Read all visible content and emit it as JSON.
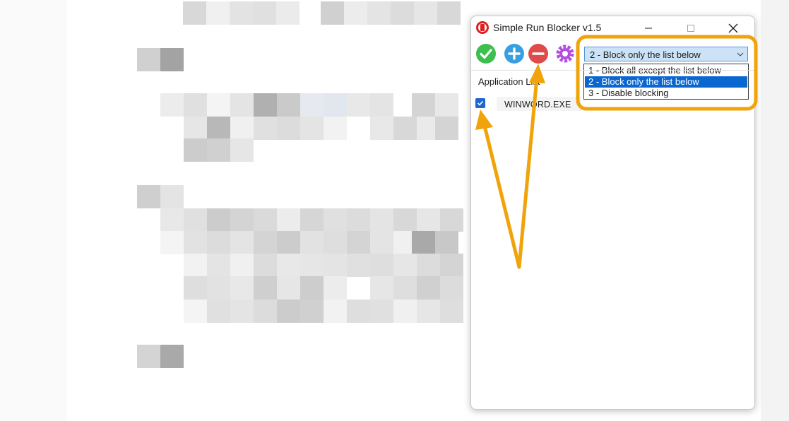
{
  "window": {
    "title": "Simple Run Blocker v1.5"
  },
  "toolbar": {
    "ok_icon": "check-circle-icon",
    "add_icon": "plus-circle-icon",
    "remove_icon": "minus-circle-icon",
    "settings_icon": "gear-icon"
  },
  "mode_select": {
    "selected": "2 - Block only the list below",
    "options": [
      "1 - Block all except the list below",
      "2 - Block only the list below",
      "3 - Disable blocking"
    ]
  },
  "list": {
    "header": "Application List",
    "items": [
      {
        "name": "WINWORD.EXE",
        "checked": true
      }
    ]
  },
  "colors": {
    "annotation": "#f0a30a",
    "selection": "#0a67d1",
    "combo_bg": "#cce3f7",
    "ok_green": "#3dbf4e",
    "add_blue": "#3a9fe0",
    "remove_red": "#e04a4a",
    "settings_purple": "#b24fe0"
  }
}
